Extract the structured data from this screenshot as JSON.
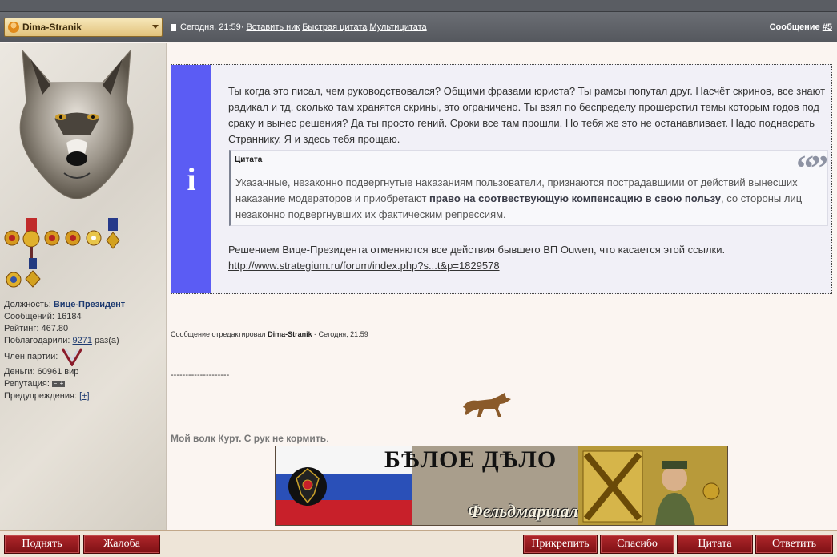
{
  "header": {
    "username": "Dima-Stranik",
    "post_time": "Сегодня, 21:59·",
    "links": [
      "Вставить ник",
      "Быстрая цитата",
      "Мультицитата"
    ],
    "post_label": "Сообщение",
    "post_number": "#5"
  },
  "sidebar": {
    "position_label": "Должность:",
    "position_value": "Вице-Президент",
    "messages": "Сообщений: 16184",
    "rating": "Рейтинг: 467.80",
    "thanks_label": "Поблагодарили:",
    "thanks_count": "9271",
    "thanks_suffix": "раз(а)",
    "party_label": "Член партии:",
    "money": "Деньги: 60961 вир",
    "reputation_label": "Репутация:",
    "warnings_label": "Предупреждения:",
    "warnings_button": "[+]",
    "rep_minus": "−",
    "rep_plus": "+"
  },
  "post": {
    "info_icon": "i",
    "paragraph": "Ты когда это писал, чем руководствовался? Общими фразами юриста? Ты рамсы попутал друг. Насчёт скринов, все знают радикал и тд. сколько там хранятся скрины, это ограничено. Ты взял по беспределу прошерстил темы которым годов под сраку и вынес решения? Да ты просто гений. Сроки все там прошли. Но тебя же это не останавливает. Надо поднасрать Страннику. Я и здесь тебя прощаю.",
    "quote_label": "Цитата",
    "quote_marks": "“”",
    "quote_before": "Указанные, незаконно подвергнутые наказаниям пользователи, признаются пострадавшими от действий вынесших наказание модераторов и приобретают ",
    "quote_bold": "право на соотвествующую компенсацию в свою пользу",
    "quote_after": ", со стороны лиц незаконно подвергнувших их фактическим репрессиям.",
    "decision": "Решением Вице-Президента отменяются все действия бывшего ВП Ouwen, что касается этой ссылки.",
    "link": "http://www.strategium.ru/forum/index.php?s...t&p=1829578"
  },
  "edited": {
    "prefix": "Сообщение отредактировал",
    "author": "Dima-Stranik",
    "suffix": "- Сегодня, 21:59"
  },
  "signature": {
    "dashes": "--------------------",
    "wolf_text": "Мой волк Курт.",
    "wolf_text_2": "С рук не кормить",
    "dot": ".",
    "banner_title": "БѢЛОЕ ДѢЛО",
    "banner_subtitle": "Фельдмаршал"
  },
  "buttons": {
    "up": "Поднять",
    "complaint": "Жалоба",
    "pin": "Прикрепить",
    "thanks": "Спасибо",
    "quote": "Цитата",
    "reply": "Ответить"
  }
}
